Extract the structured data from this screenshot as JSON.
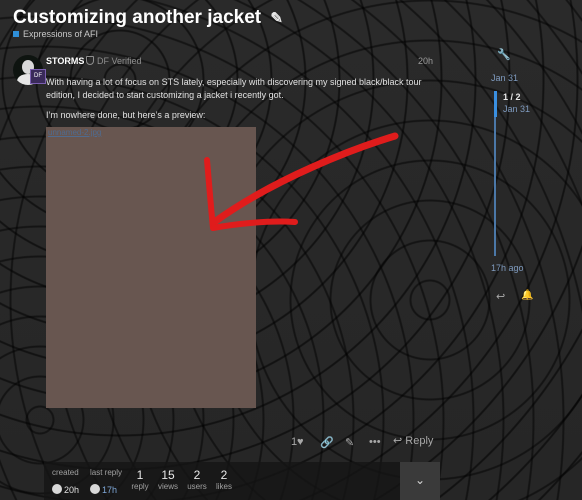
{
  "topic": {
    "title": "Customizing another jacket",
    "title_icon": "pencil-icon",
    "category": "Expressions of AFI",
    "category_color": "#2f8fd8"
  },
  "post": {
    "username": "STORMS",
    "user_title": "DF Verified",
    "flair_text": "DF",
    "date": "20h",
    "text_1": "With having a lot of focus on STS lately, especially with discovering my signed black/black tour edition, I decided to start customizing a jacket i recently got.",
    "text_2": "I’m nowhere done, but here’s a preview:",
    "image_link_text": "unnamed-2.jpg",
    "image_color": "#685650",
    "annotation_arrow_color": "#e01c1c"
  },
  "post_actions": {
    "like_count": "1",
    "like_icon": "heart-icon",
    "link_icon": "link-icon",
    "edit_icon": "pencil-icon",
    "more_icon": "ellipsis-icon",
    "reply_label": "Reply"
  },
  "timeline": {
    "top_date": "Jan 31",
    "position": "1 / 2",
    "position_date": "Jan 31",
    "bottom_date": "17h ago",
    "progress_fraction": 0.5
  },
  "footer": {
    "created_label": "created",
    "created_value": "20h",
    "last_reply_label": "last reply",
    "last_reply_value": "17h",
    "replies": "1",
    "replies_label": "reply",
    "views": "15",
    "views_label": "views",
    "users": "2",
    "users_label": "users",
    "likes": "2",
    "likes_label": "likes"
  }
}
